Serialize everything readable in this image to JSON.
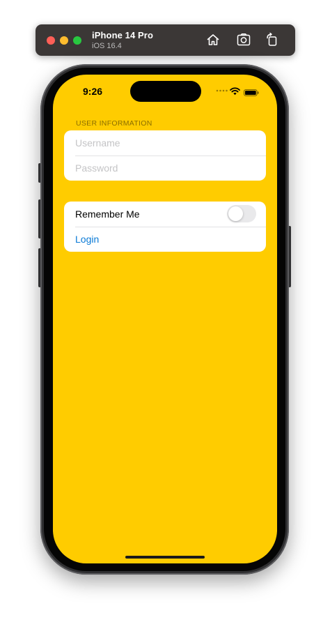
{
  "simulator": {
    "device_name": "iPhone 14 Pro",
    "os_version": "iOS 16.4",
    "toolbar_icons": [
      "home-icon",
      "screenshot-icon",
      "rotate-icon"
    ]
  },
  "status_bar": {
    "time": "9:26",
    "icons": [
      "signal-dots-icon",
      "wifi-icon",
      "battery-icon"
    ]
  },
  "form": {
    "section_header": "USER INFORMATION",
    "username": {
      "value": "",
      "placeholder": "Username"
    },
    "password": {
      "value": "",
      "placeholder": "Password"
    },
    "remember_me": {
      "label": "Remember Me",
      "on": false
    },
    "login_label": "Login"
  },
  "colors": {
    "screen_background": "#ffcc00",
    "link": "#0a7ad6",
    "toggle_off_track": "#e9e9eb"
  }
}
